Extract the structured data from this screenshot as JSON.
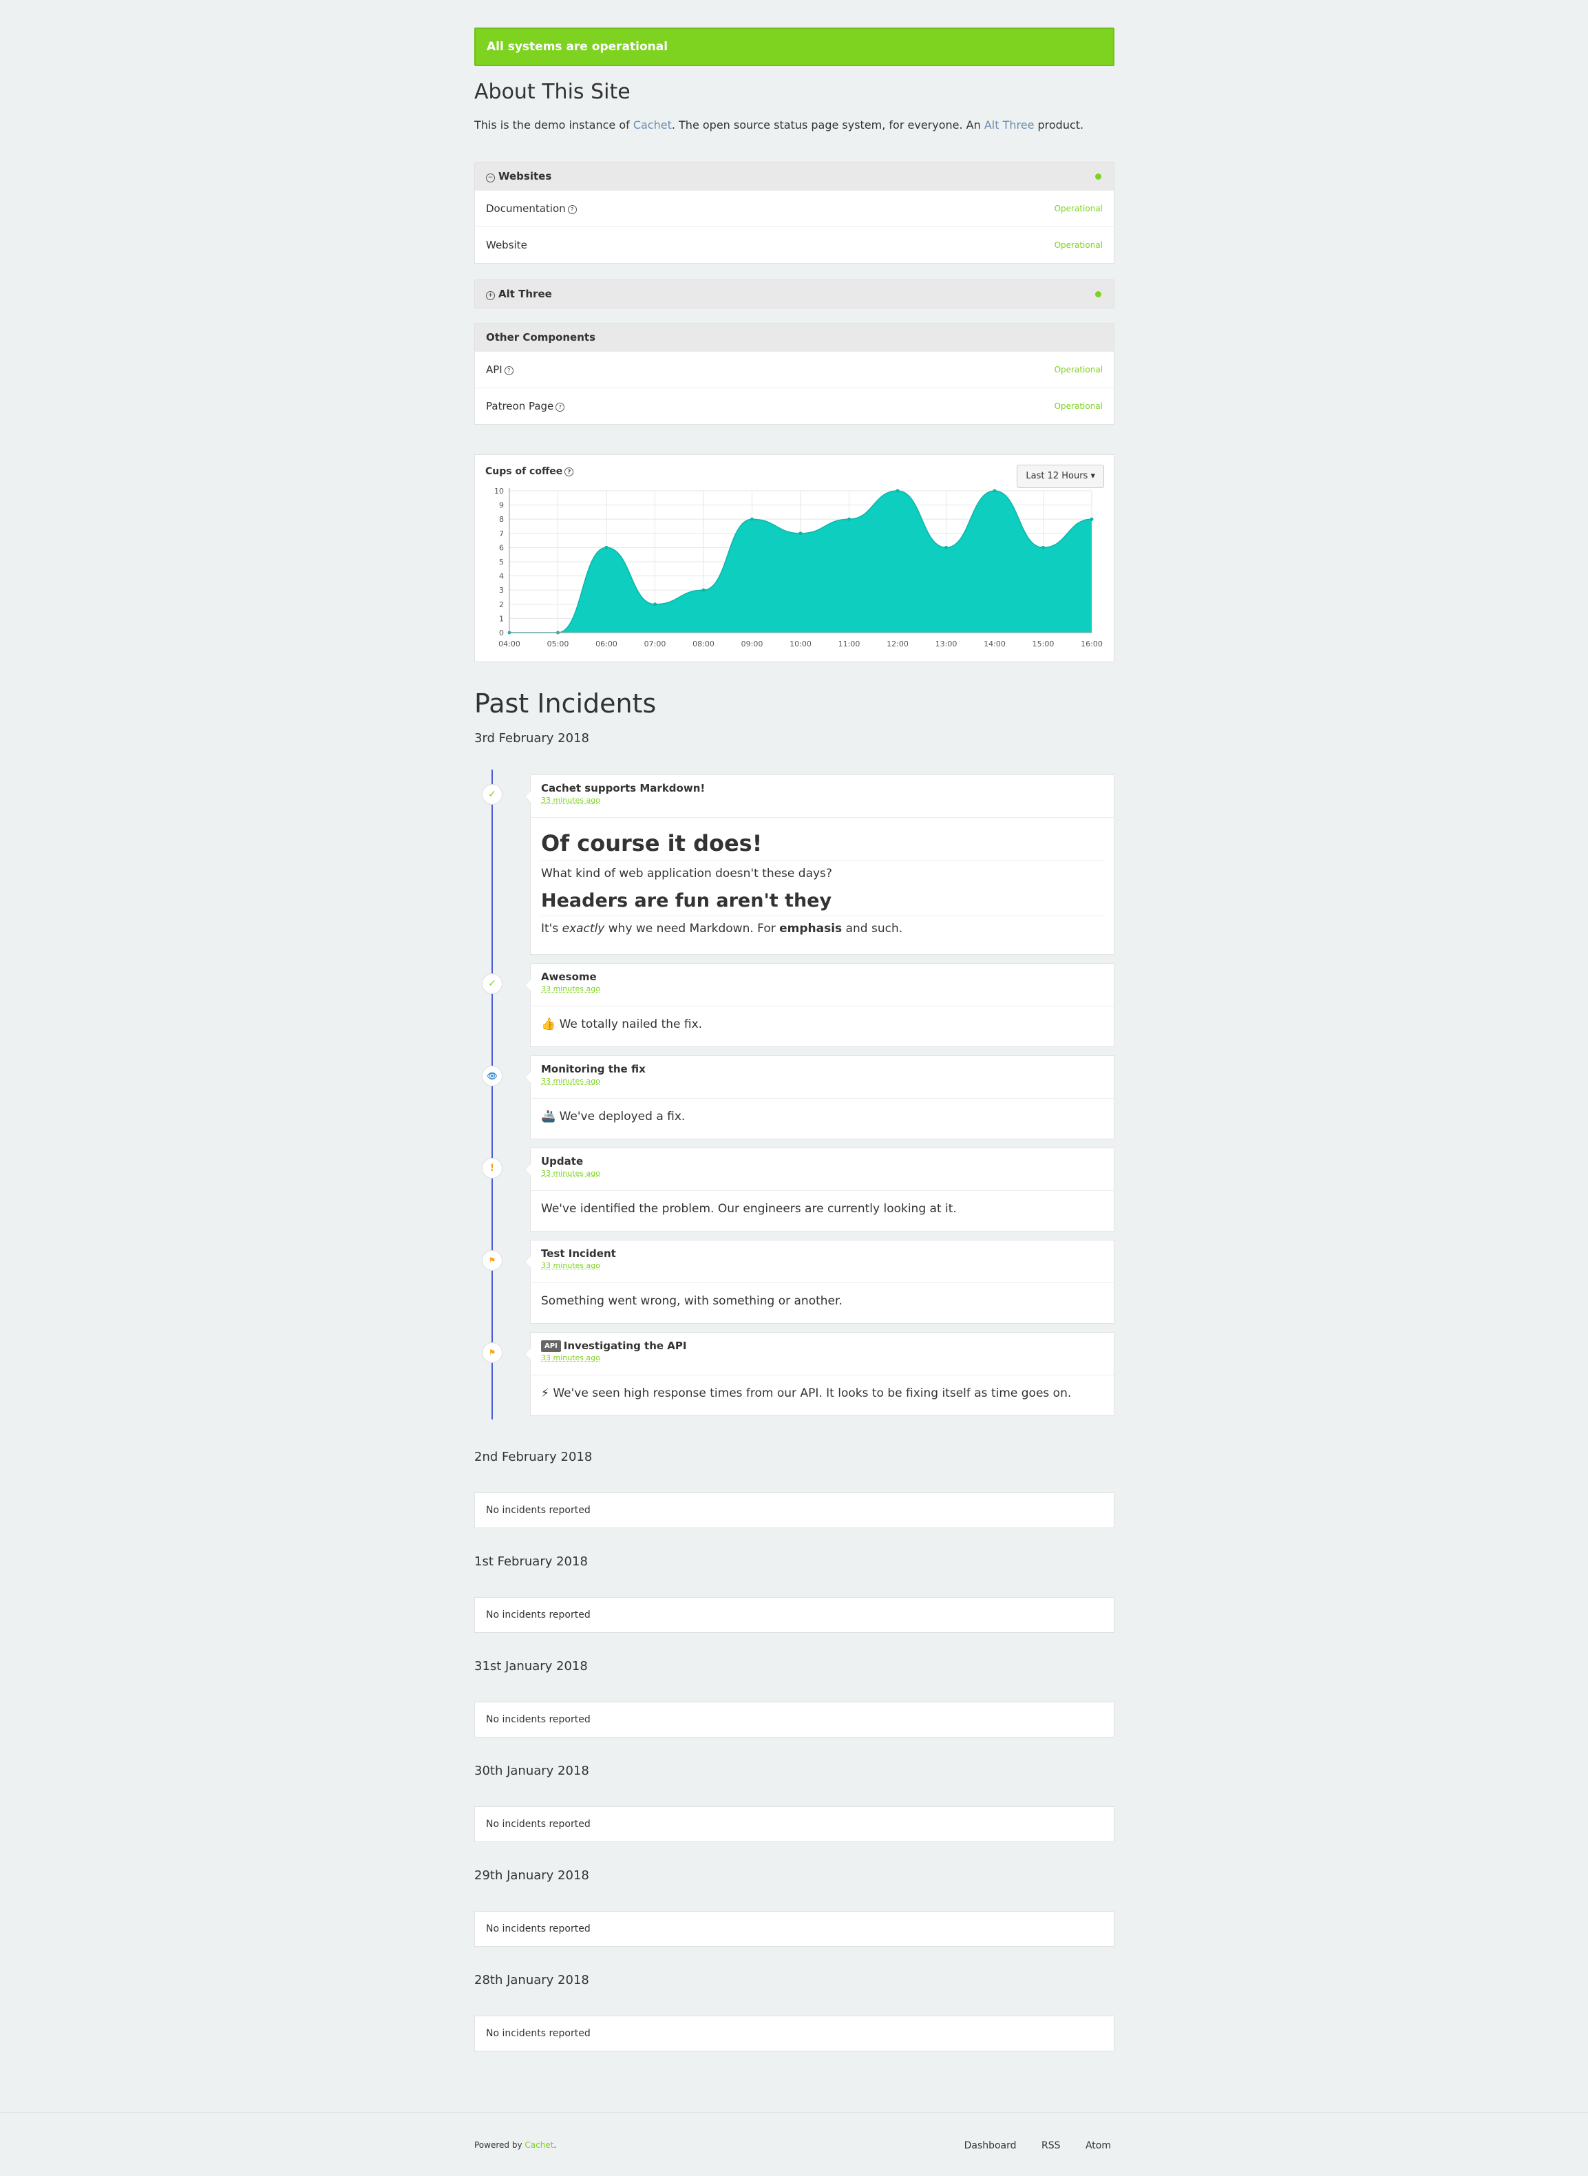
{
  "banner": {
    "text": "All systems are operational"
  },
  "about": {
    "title": "About This Site",
    "text_before": "This is the demo instance of ",
    "link1": "Cachet",
    "text_middle": ". The open source status page system, for everyone. An ",
    "link2": "Alt Three",
    "text_after": " product."
  },
  "groups": {
    "websites": {
      "name": "Websites",
      "toggle_icon": "−",
      "components": [
        {
          "name": "Documentation",
          "status": "Operational"
        },
        {
          "name": "Website",
          "status": "Operational"
        }
      ]
    },
    "alt_three": {
      "name": "Alt Three",
      "toggle_icon": "+"
    },
    "other": {
      "name": "Other Components",
      "components": [
        {
          "name": "API",
          "status": "Operational"
        },
        {
          "name": "Patreon Page",
          "status": "Operational"
        }
      ]
    },
    "status_color": "#7ed321"
  },
  "metric": {
    "title": "Cups of coffee",
    "range_label": "Last 12 Hours ▾"
  },
  "chart_data": {
    "type": "area",
    "title": "Cups of coffee",
    "x": [
      "04:00",
      "05:00",
      "06:00",
      "07:00",
      "08:00",
      "09:00",
      "10:00",
      "11:00",
      "12:00",
      "13:00",
      "14:00",
      "15:00",
      "16:00"
    ],
    "values": [
      0,
      0,
      6,
      2,
      3,
      8,
      7,
      8,
      10,
      6,
      10,
      6,
      8
    ],
    "ylim": [
      0,
      10
    ],
    "yticks": [
      0,
      1,
      2,
      3,
      4,
      5,
      6,
      7,
      8,
      9,
      10
    ],
    "grid": true,
    "color": "#0ecec0"
  },
  "past_incidents": {
    "title": "Past Incidents",
    "date": "3rd February 2018",
    "incidents": [
      {
        "title": "Cachet supports Markdown!",
        "time": "33 minutes ago",
        "icon": "check-icon",
        "h1": "Of course it does!",
        "p1": "What kind of web application doesn't these days?",
        "h2": "Headers are fun aren't they",
        "p2_a": "It's ",
        "p2_em": "exactly",
        "p2_b": " why we need Markdown. For ",
        "p2_strong": "emphasis",
        "p2_c": " and such."
      },
      {
        "title": "Awesome",
        "time": "33 minutes ago",
        "icon": "check-icon",
        "emoji": "👍",
        "body": " We totally nailed the fix."
      },
      {
        "title": "Monitoring the fix",
        "time": "33 minutes ago",
        "icon": "eye-icon",
        "emoji": "🚢",
        "body": " We've deployed a fix."
      },
      {
        "title": "Update",
        "time": "33 minutes ago",
        "icon": "exclamation-icon",
        "body": "We've identified the problem. Our engineers are currently looking at it."
      },
      {
        "title": "Test Incident",
        "time": "33 minutes ago",
        "icon": "flag-icon",
        "body": "Something went wrong, with something or another."
      },
      {
        "title": "Investigating the API",
        "badge": "API",
        "time": "33 minutes ago",
        "icon": "flag-icon",
        "emoji": "⚡",
        "body": " We've seen high response times from our API. It looks to be fixing itself as time goes on."
      }
    ],
    "empty_days": [
      {
        "date": "2nd February 2018",
        "text": "No incidents reported"
      },
      {
        "date": "1st February 2018",
        "text": "No incidents reported"
      },
      {
        "date": "31st January 2018",
        "text": "No incidents reported"
      },
      {
        "date": "30th January 2018",
        "text": "No incidents reported"
      },
      {
        "date": "29th January 2018",
        "text": "No incidents reported"
      },
      {
        "date": "28th January 2018",
        "text": "No incidents reported"
      }
    ]
  },
  "footer": {
    "powered_prefix": "Powered by ",
    "powered_link": "Cachet",
    "powered_suffix": ".",
    "links": [
      "Dashboard",
      "RSS",
      "Atom"
    ]
  }
}
